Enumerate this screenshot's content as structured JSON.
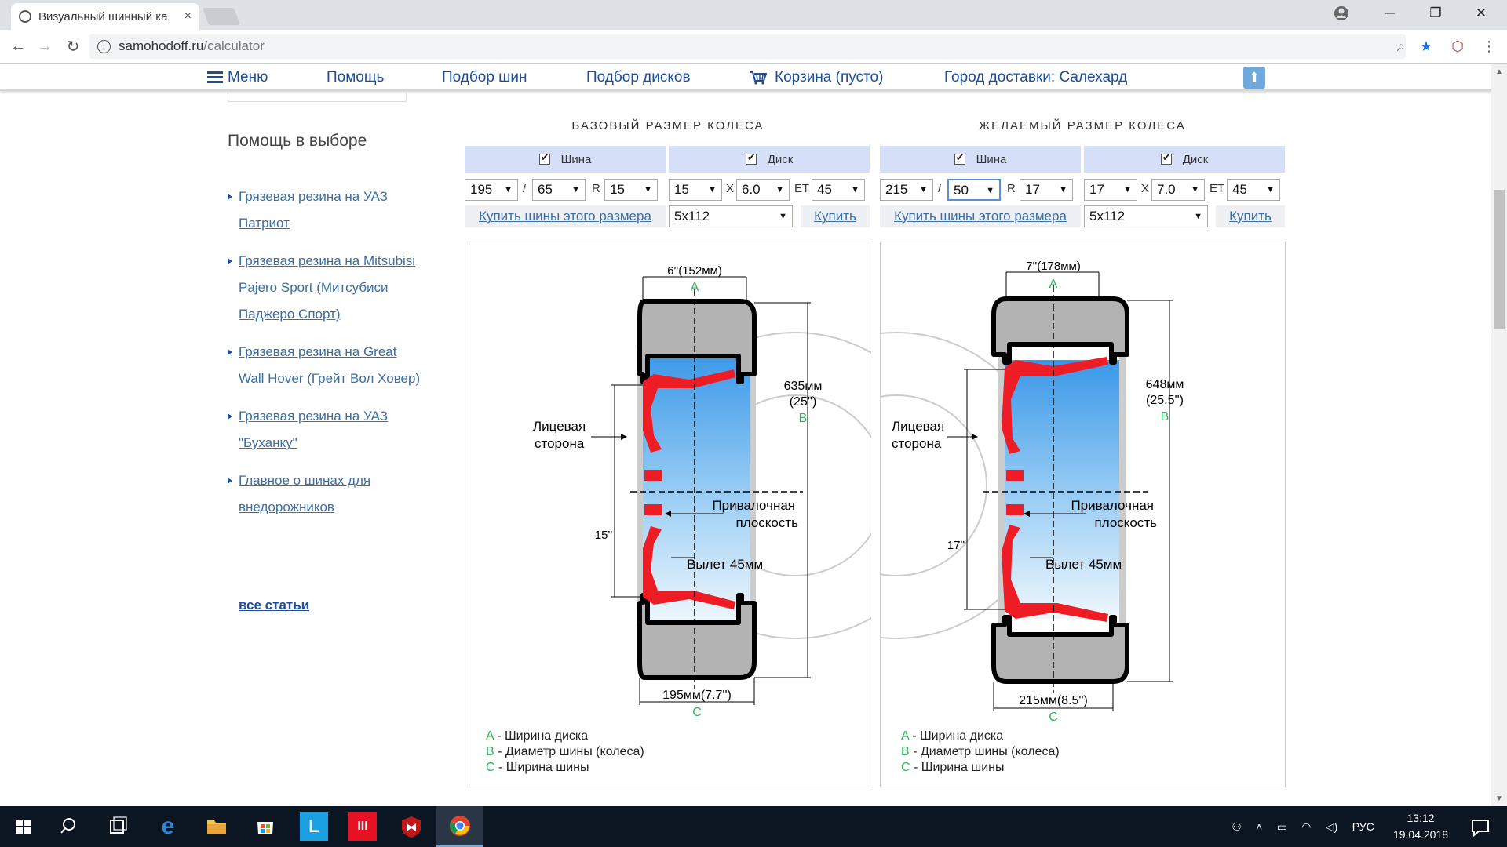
{
  "browser": {
    "tab_title": "Визуальный шинный ка",
    "tab_close": "×",
    "url_host": "samohodoff.ru",
    "url_path": "/calculator",
    "win_min": "─",
    "win_max": "❐",
    "win_close": "✕",
    "back": "←",
    "forward": "→",
    "reload": "↻",
    "zoom_icon": "⌕",
    "star": "★",
    "ext": "⬡",
    "menu": "⋮",
    "info": "i"
  },
  "nav": {
    "menu": "Меню",
    "help": "Помощь",
    "tires": "Подбор шин",
    "discs": "Подбор дисков",
    "cart": "Корзина (пусто)",
    "city": "Город доставки: Салехард",
    "up": "⬆"
  },
  "sidebar": {
    "heading": "Помощь в выборе",
    "items": [
      {
        "label": "Грязевая резина на УАЗ Патриот"
      },
      {
        "label": "Грязевая резина на Mitsubisi Pajero Sport (Митсубиси Паджеро Спорт)"
      },
      {
        "label": "Грязевая резина на Great Wall Hover (Грейт Вол Ховер)"
      },
      {
        "label": "Грязевая резина на УАЗ \"Буханку\""
      },
      {
        "label": "Главное о шинах для внедорожников"
      }
    ],
    "all": "все статьи"
  },
  "base": {
    "title": "БАЗОВЫЙ РАЗМЕР КОЛЕСА",
    "tire_label": "Шина",
    "disc_label": "Диск",
    "width": "195",
    "profile": "65",
    "r_label": "R",
    "diameter": "15",
    "disc_d": "15",
    "x_label": "X",
    "disc_w": "6.0",
    "et_label": "ET",
    "et": "45",
    "slash": "/",
    "buy_tires": "Купить шины этого размера",
    "pcd": "5x112",
    "buy": "Купить"
  },
  "desired": {
    "title": "ЖЕЛАЕМЫЙ РАЗМЕР КОЛЕСА",
    "tire_label": "Шина",
    "disc_label": "Диск",
    "width": "215",
    "profile": "50",
    "r_label": "R",
    "diameter": "17",
    "disc_d": "17",
    "x_label": "X",
    "disc_w": "7.0",
    "et_label": "ET",
    "et": "45",
    "slash": "/",
    "buy_tires": "Купить шины этого размера",
    "pcd": "5x112",
    "buy": "Купить"
  },
  "diagram_base": {
    "a_dim": "6''(152мм)",
    "b_mm": "635мм",
    "b_in": "(25'')",
    "rim_in": "15''",
    "c_dim": "195мм(7.7'')",
    "offset": "Вылет 45мм"
  },
  "diagram_desired": {
    "a_dim": "7''(178мм)",
    "b_mm": "648мм",
    "b_in": "(25.5'')",
    "rim_in": "17''",
    "c_dim": "215мм(8.5'')",
    "offset": "Вылет 45мм"
  },
  "diagram_common": {
    "face1": "Лицевая",
    "face2": "сторона",
    "mount1": "Привалочная",
    "mount2": "плоскость",
    "A": "A",
    "B": "B",
    "C": "C"
  },
  "legend": {
    "a": "A",
    "a_text": " - Ширина диска",
    "b": "B",
    "b_text": " - Диаметр шины (колеса)",
    "c": "C",
    "c_text": " - Ширина шины"
  },
  "taskbar": {
    "lang": "РУС",
    "time": "13:12",
    "date": "19.04.2018"
  },
  "colors": {
    "link": "#3a6ea5",
    "nav": "#1e4d9b",
    "header_bg": "#d6dff8",
    "label_green": "#2fb457",
    "rim_red": "#ee1c24",
    "tire_gray": "#b3b3b3"
  }
}
